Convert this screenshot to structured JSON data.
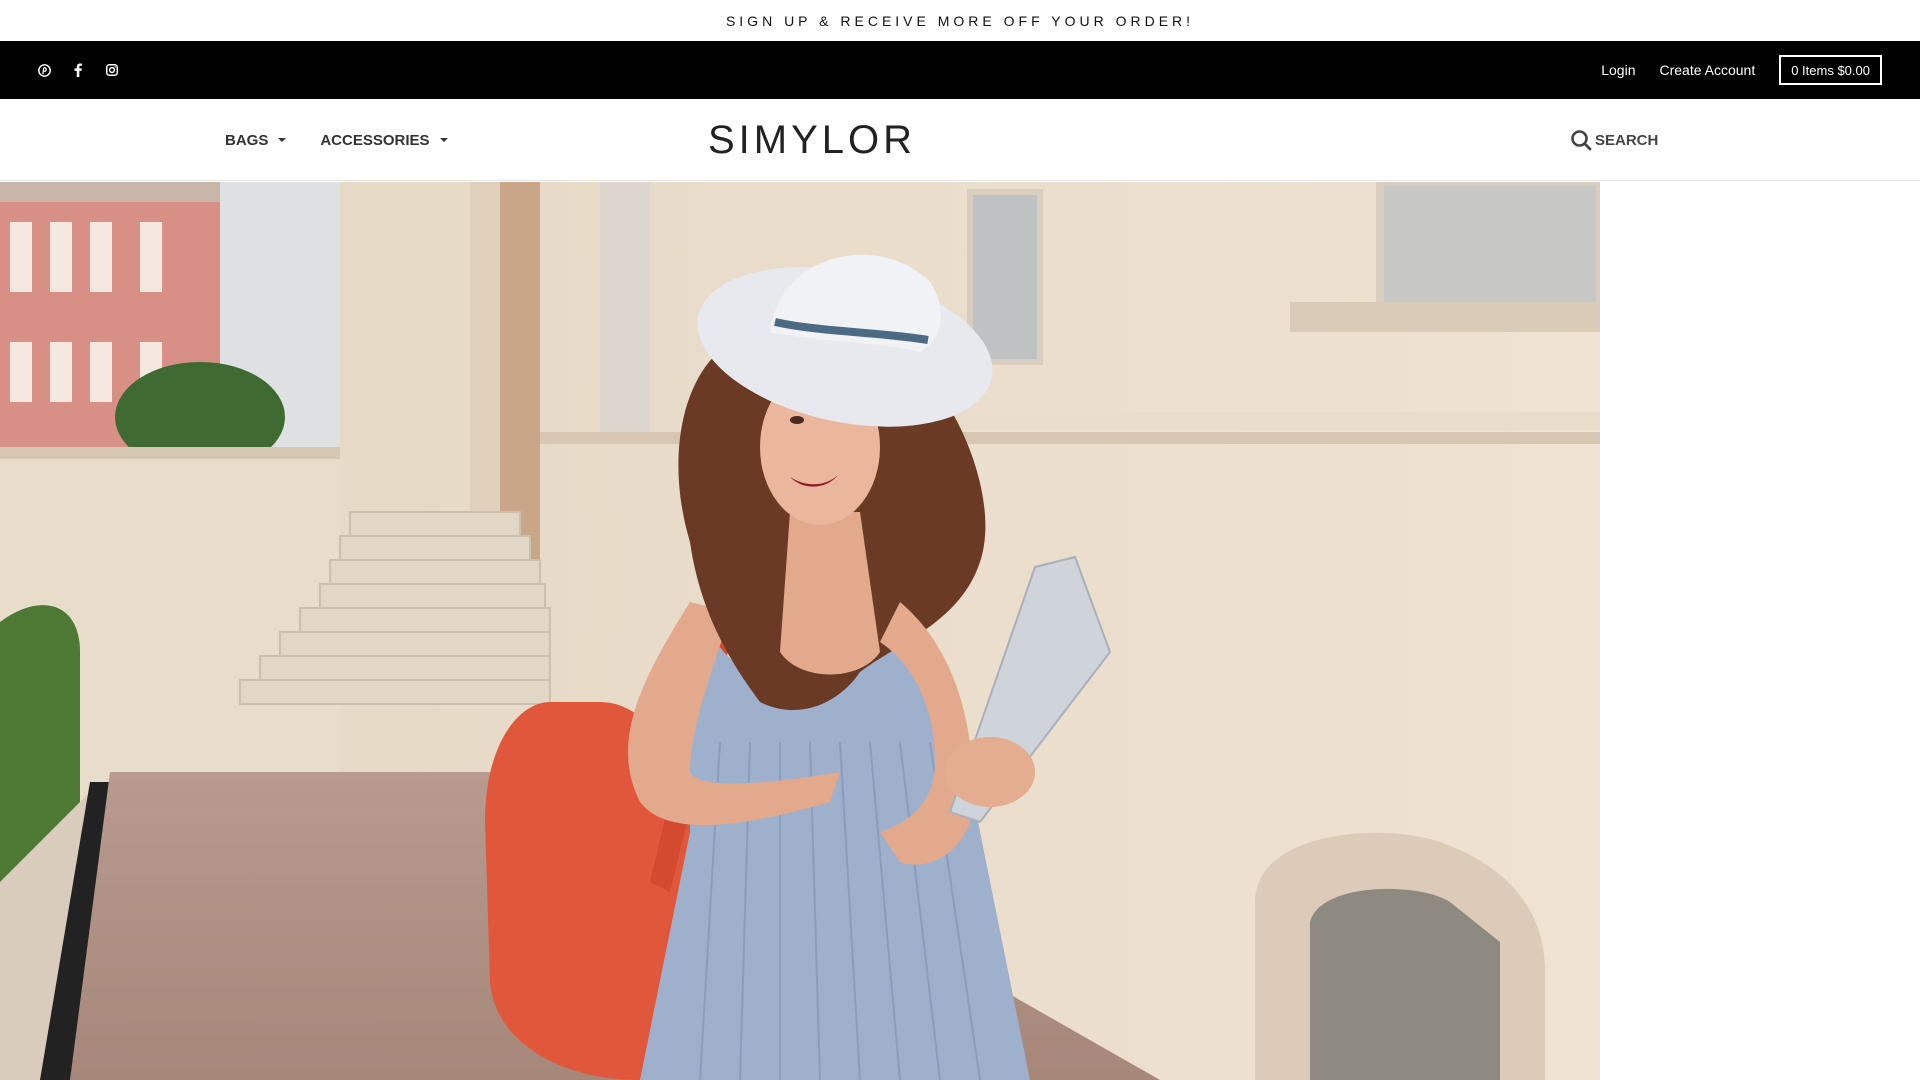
{
  "announcement": {
    "text": "SIGN UP & RECEIVE MORE OFF YOUR ORDER!"
  },
  "utility_bar": {
    "social_icons": [
      "pinterest-icon",
      "facebook-icon",
      "instagram-icon"
    ],
    "login_label": "Login",
    "create_account_label": "Create Account",
    "cart_label": "0 Items $0.00"
  },
  "header": {
    "nav": [
      {
        "label": "BAGS"
      },
      {
        "label": "ACCESSORIES"
      }
    ],
    "logo": "SIMYLOR",
    "search_label": "SEARCH"
  },
  "hero": {
    "image": "woman-with-hat-and-orange-backpack",
    "colors": {
      "wall": "#e9dccd",
      "backpack": "#e0573b",
      "dress": "#9fb0cc"
    }
  }
}
